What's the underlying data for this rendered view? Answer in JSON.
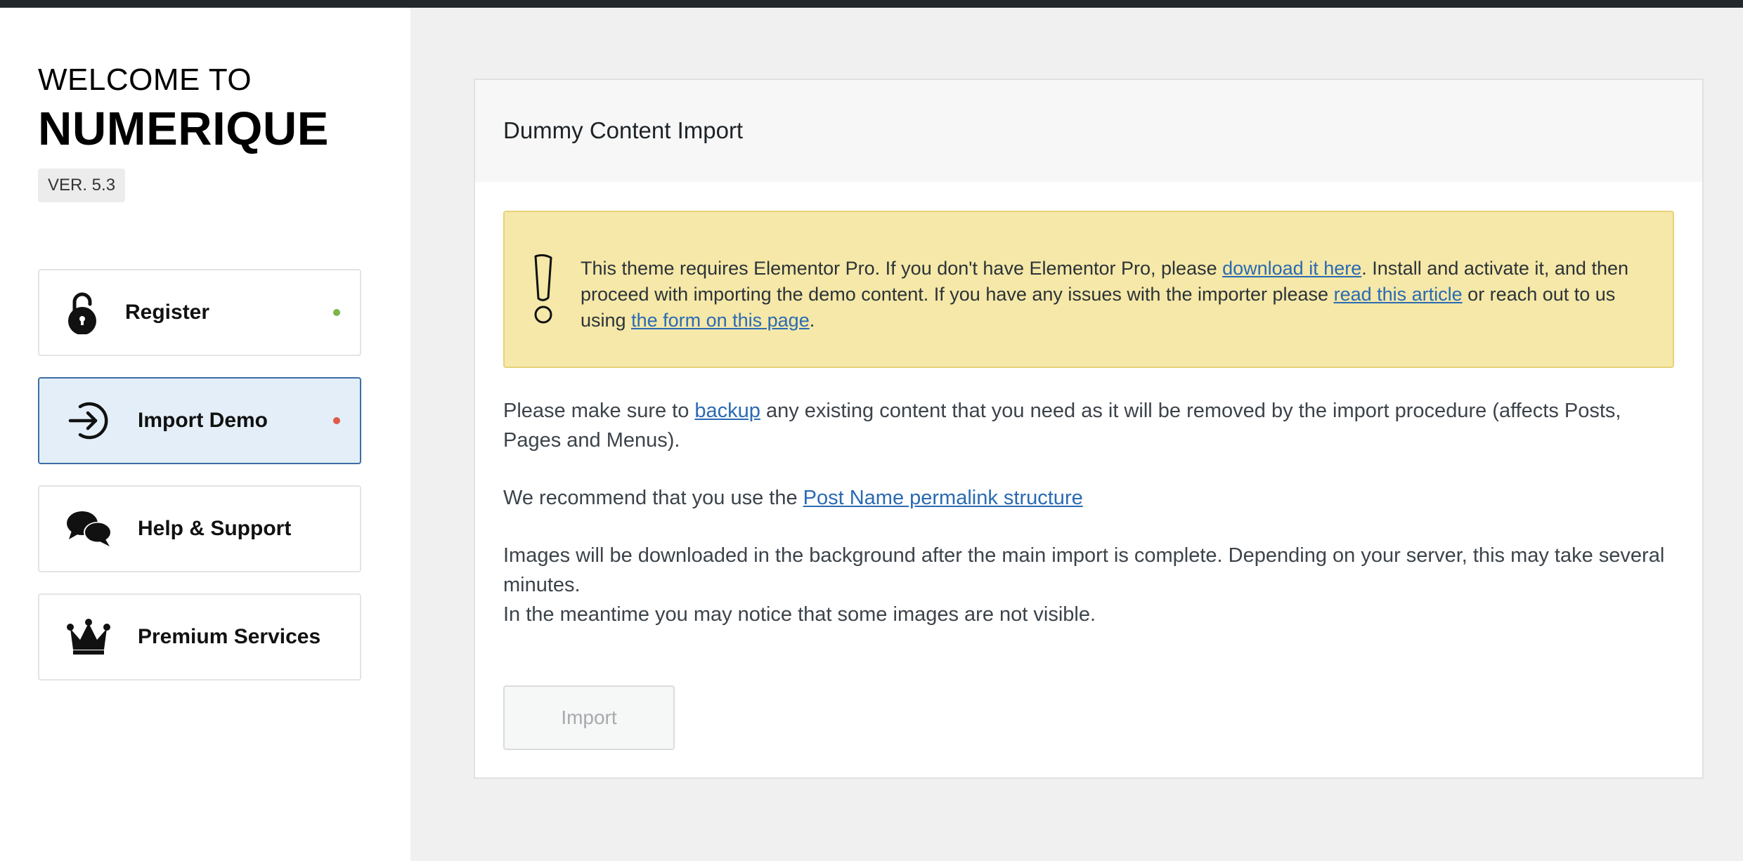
{
  "sidebar": {
    "welcome": "WELCOME TO",
    "brand": "NUMERIQUE",
    "version": "VER. 5.3",
    "items": [
      {
        "label": "Register",
        "icon": "unlock-icon",
        "dot_color": "#7ab648"
      },
      {
        "label": "Import Demo",
        "icon": "arrow-circle-right-icon",
        "dot_color": "#e05a47",
        "active": true
      },
      {
        "label": "Help & Support",
        "icon": "chat-bubbles-icon"
      },
      {
        "label": "Premium Services",
        "icon": "crown-icon"
      }
    ]
  },
  "panel": {
    "title": "Dummy Content Import",
    "notice": {
      "icon": "exclamation-icon",
      "t1": "This theme requires Elementor Pro. If you don't have Elementor Pro, please ",
      "link1": "download it here",
      "t2": ". Install and activate it, and then proceed with importing the demo content. If you have any issues with the importer please ",
      "link2": "read this article",
      "t3": " or reach out to us using ",
      "link3": "the form on this page",
      "t4": "."
    },
    "p1": {
      "t1": "Please make sure to ",
      "link": "backup",
      "t2": " any existing content that you need as it will be removed by the import procedure (affects Posts, Pages and Menus)."
    },
    "p2": {
      "t1": "We recommend that you use the ",
      "link": "Post Name permalink structure"
    },
    "p3": {
      "line1": "Images will be downloaded in the background after the main import is complete. Depending on your server, this may take several minutes.",
      "line2": "In the meantime you may notice that some images are not visible."
    },
    "import_button": "Import"
  },
  "colors": {
    "accent": "#2a6ab3",
    "notice_bg": "#f5e8a8",
    "active_bg": "#e3eef8",
    "active_border": "#3b6fa3"
  }
}
